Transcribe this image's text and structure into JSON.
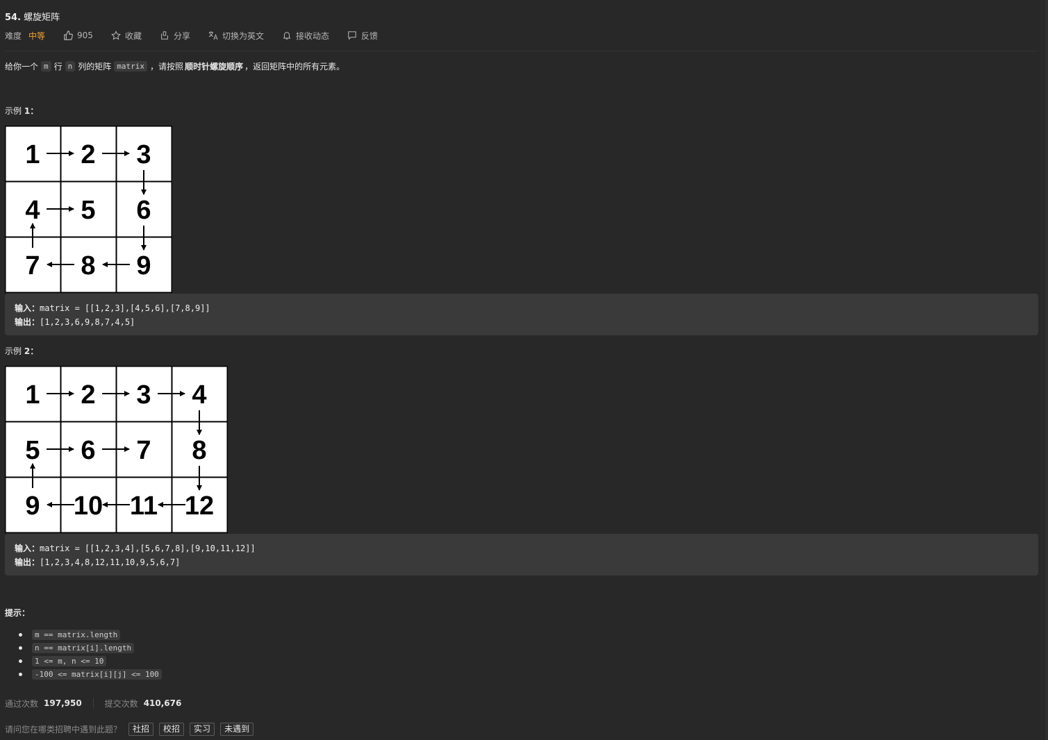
{
  "problem": {
    "number": "54.",
    "title": "螺旋矩阵"
  },
  "meta": {
    "difficulty_label": "难度",
    "difficulty_value": "中等",
    "likes": "905",
    "favorite": "收藏",
    "share": "分享",
    "switch_lang": "切换为英文",
    "subscribe": "接收动态",
    "feedback": "反馈"
  },
  "description": {
    "p1": "给你一个",
    "m": "m",
    "p2": "行",
    "n": "n",
    "p3": "列的矩阵",
    "matrix": "matrix",
    "p4": "，请按照",
    "bold": "顺时针螺旋顺序",
    "p5": "，返回矩阵中的所有元素。"
  },
  "examples": [
    {
      "title_prefix": "示例",
      "title_num": "1：",
      "grid": [
        [
          "1",
          "2",
          "3"
        ],
        [
          "4",
          "5",
          "6"
        ],
        [
          "7",
          "8",
          "9"
        ]
      ],
      "input_label": "输入：",
      "input": "matrix = [[1,2,3],[4,5,6],[7,8,9]]",
      "output_label": "输出：",
      "output": "[1,2,3,6,9,8,7,4,5]"
    },
    {
      "title_prefix": "示例",
      "title_num": "2：",
      "grid": [
        [
          "1",
          "2",
          "3",
          "4"
        ],
        [
          "5",
          "6",
          "7",
          "8"
        ],
        [
          "9",
          "10",
          "11",
          "12"
        ]
      ],
      "input_label": "输入：",
      "input": "matrix = [[1,2,3,4],[5,6,7,8],[9,10,11,12]]",
      "output_label": "输出：",
      "output": "[1,2,3,4,8,12,11,10,9,5,6,7]"
    }
  ],
  "hints": {
    "title": "提示：",
    "items": [
      "m == matrix.length",
      "n == matrix[i].length",
      "1 <= m, n <= 10",
      "-100 <= matrix[i][j] <= 100"
    ]
  },
  "stats": {
    "accepted_label": "通过次数",
    "accepted_value": "197,950",
    "submitted_label": "提交次数",
    "submitted_value": "410,676"
  },
  "survey": {
    "question": "请问您在哪类招聘中遇到此题？",
    "options": [
      "社招",
      "校招",
      "实习",
      "未遇到"
    ]
  }
}
